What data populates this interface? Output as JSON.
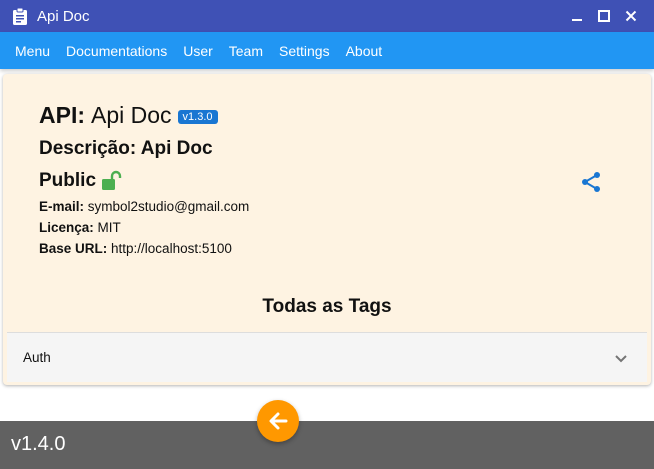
{
  "window": {
    "title": "Api Doc",
    "app_icon": "clipboard-icon",
    "controls": [
      "minimize-icon",
      "maximize-icon",
      "close-icon"
    ]
  },
  "menubar": {
    "items": [
      "Menu",
      "Documentations",
      "User",
      "Team",
      "Settings",
      "About"
    ]
  },
  "api": {
    "label": "API:",
    "name": "Api Doc",
    "version": "v1.3.0",
    "description_label": "Descrição:",
    "description": "Api Doc",
    "visibility": "Public",
    "visibility_icon": "lock-open-icon",
    "email_label": "E-mail:",
    "email": "symbol2studio@gmail.com",
    "license_label": "Licença:",
    "license": "MIT",
    "base_url_label": "Base URL:",
    "base_url": "http://localhost:5100",
    "share_icon": "share-icon"
  },
  "tags": {
    "title": "Todas as Tags",
    "items": [
      {
        "label": "Auth",
        "icon": "chevron-down-icon"
      }
    ]
  },
  "footer": {
    "version": "v1.4.0",
    "fab_icon": "arrow-left-icon"
  },
  "colors": {
    "titlebar": "#3f51b5",
    "menubar": "#2196f3",
    "card_bg": "#fef3e2",
    "badge": "#1976d2",
    "lock_open": "#4caf50",
    "share": "#1976d2",
    "fab": "#ff9800",
    "footer": "#616161"
  }
}
